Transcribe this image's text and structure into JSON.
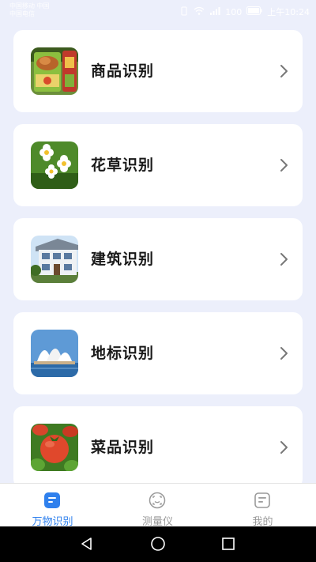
{
  "status": {
    "carrier_line1": "中国移动 中国",
    "carrier_line2": "中国电信",
    "battery": "100",
    "time": "上午10:24"
  },
  "cards": [
    {
      "label": "商品识别",
      "icon": "goods-thumbnail"
    },
    {
      "label": "花草识别",
      "icon": "flowers-thumbnail"
    },
    {
      "label": "建筑识别",
      "icon": "building-thumbnail"
    },
    {
      "label": "地标识别",
      "icon": "landmark-thumbnail"
    },
    {
      "label": "菜品识别",
      "icon": "dish-thumbnail"
    }
  ],
  "bottom_nav": {
    "items": [
      {
        "label": "万物识别",
        "icon": "recognize-icon",
        "active": true
      },
      {
        "label": "测量仪",
        "icon": "measure-icon",
        "active": false
      },
      {
        "label": "我的",
        "icon": "profile-icon",
        "active": false
      }
    ]
  },
  "colors": {
    "accent": "#2f80ed",
    "background": "#eceffb",
    "inactive": "#9a9a9a"
  }
}
